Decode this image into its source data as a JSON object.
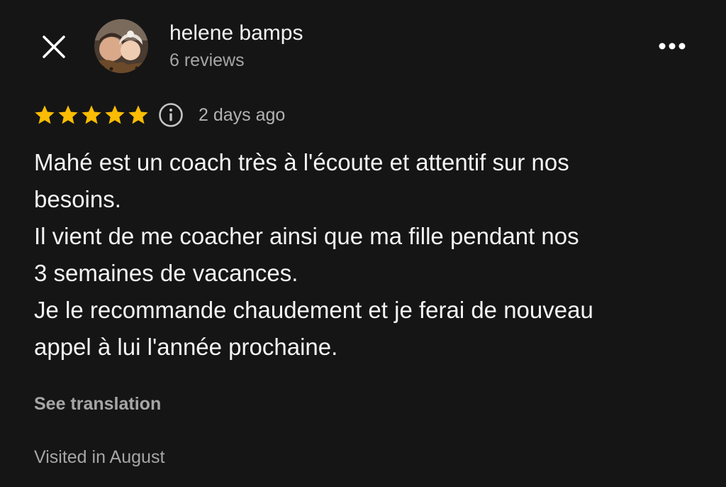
{
  "reviewer": {
    "name": "helene bamps",
    "reviews_count": "6 reviews"
  },
  "rating": {
    "stars": 5,
    "max_stars": 5,
    "date": "2 days ago"
  },
  "review": {
    "lines": [
      "Mahé est un coach très à l'écoute et attentif sur nos",
      "besoins.",
      "Il vient de me coacher ainsi que ma fille pendant nos",
      "3 semaines de vacances.",
      "Je le recommande chaudement et je ferai de nouveau",
      "appel à lui l'année prochaine."
    ]
  },
  "actions": {
    "see_translation": "See translation"
  },
  "visit": {
    "label": "Visited in August"
  },
  "colors": {
    "background": "#151515",
    "star": "#fbbc04",
    "muted_text": "#a6a6a6"
  },
  "icons": {
    "close": "close-icon",
    "more": "more-horizontal-icon",
    "info": "info-icon",
    "star": "star-icon"
  }
}
